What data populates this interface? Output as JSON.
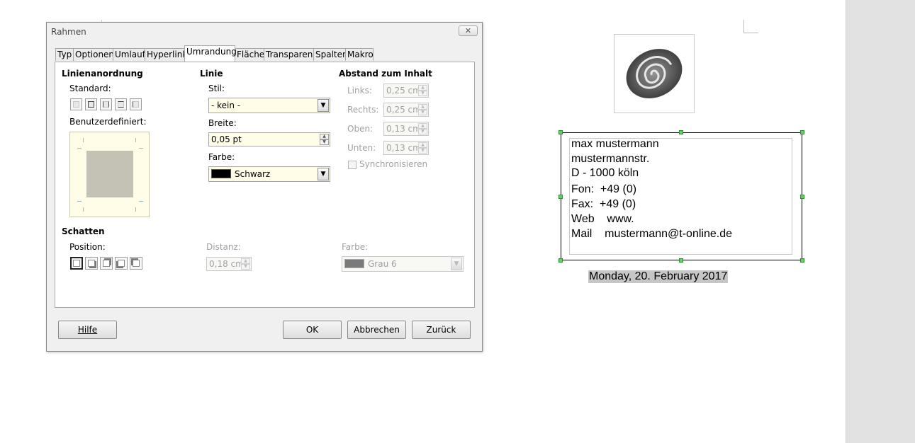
{
  "dialog": {
    "title": "Rahmen",
    "close_glyph": "✕",
    "tabs": [
      "Typ",
      "Optionen",
      "Umlauf",
      "Hyperlink",
      "Umrandung",
      "Fläche",
      "Transparenz",
      "Spalten",
      "Makro"
    ],
    "active_tab": "Umrandung",
    "line_arrangement": {
      "heading": "Linienanordnung",
      "standard_label": "Standard:",
      "custom_label": "Benutzerdefiniert:"
    },
    "line": {
      "heading": "Linie",
      "style_label": "Stil:",
      "style_value": "- kein -",
      "width_label": "Breite:",
      "width_value": "0,05 pt",
      "color_label": "Farbe:",
      "color_value": "Schwarz",
      "color_hex": "#000000"
    },
    "spacing": {
      "heading": "Abstand zum Inhalt",
      "left_label": "Links:",
      "left_value": "0,25 cm",
      "right_label": "Rechts:",
      "right_value": "0,25 cm",
      "top_label": "Oben:",
      "top_value": "0,13 cm",
      "bottom_label": "Unten:",
      "bottom_value": "0,13 cm",
      "sync_label": "Synchronisieren"
    },
    "shadow": {
      "heading": "Schatten",
      "position_label": "Position:",
      "distance_label": "Distanz:",
      "distance_value": "0,18 cm",
      "color_label": "Farbe:",
      "color_value": "Grau 6",
      "color_hex": "#7a7a7a"
    },
    "buttons": {
      "help": "Hilfe",
      "ok": "OK",
      "cancel": "Abbrechen",
      "reset": "Zurück"
    }
  },
  "document": {
    "address_lines": [
      "max mustermann",
      "mustermannstr.",
      "D - 1000 köln",
      "Fon:  +49 (0)",
      "Fax:  +49 (0)",
      "Web    www.",
      "Mail    mustermann@t-online.de"
    ],
    "date": "Monday, 20. February 2017"
  },
  "colors": {
    "selection_handle": "#5fd35f",
    "input_bg": "#fffde8"
  }
}
